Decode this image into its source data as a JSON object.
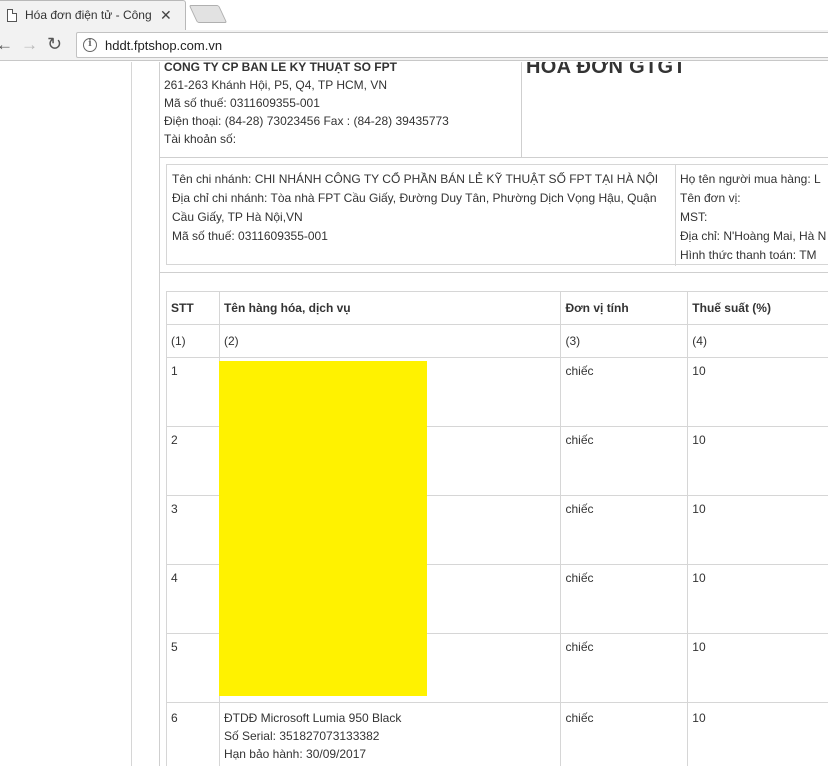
{
  "browser": {
    "tab_title": "Hóa đơn điện tử - Công ty",
    "tab_close": "✕",
    "url": "hddt.fptshop.com.vn",
    "icons": {
      "back": "back-arrow-icon",
      "forward": "forward-arrow-icon",
      "reload": "reload-icon",
      "info": "info-icon",
      "page": "document-icon"
    }
  },
  "seller": {
    "name": "CÔNG TY CP BÁN LẺ KỸ THUẬT SỐ FPT",
    "address": "261-263 Khánh Hội, P5, Q4, TP HCM, VN",
    "tax_code": "Mã số thuế: 0311609355-001",
    "phone": "Điện thoại: (84-28) 73023456 Fax : (84-28) 39435773",
    "account": "Tài khoản số:"
  },
  "doc_title": "HÓA ĐƠN GTGT",
  "branch": {
    "name": "Tên chi nhánh: CHI NHÁNH CÔNG TY CỔ PHẦN BÁN LẺ KỸ THUẬT SỐ FPT TẠI HÀ NỘI",
    "address": "Địa chỉ chi nhánh: Tòa nhà FPT Cầu Giấy, Đường Duy Tân, Phường Dịch Vọng Hậu, Quận Cầu Giấy, TP Hà Nội,VN",
    "tax_code": "Mã số thuế: 0311609355-001"
  },
  "buyer": {
    "name": "Họ tên người mua hàng: L",
    "unit": "Tên đơn vị:",
    "tax_code": "MST:",
    "address": "Địa chỉ: N'Hoàng Mai, Hà N",
    "payment": "Hình thức thanh toán: TM"
  },
  "table": {
    "headers": [
      "STT",
      "Tên hàng hóa, dịch vụ",
      "Đơn vị tính",
      "Thuế suất (%)"
    ],
    "col_numbers": [
      "(1)",
      "(2)",
      "(3)",
      "(4)"
    ],
    "rows": [
      {
        "stt": "1",
        "unit": "chiếc",
        "tax": "10"
      },
      {
        "stt": "2",
        "unit": "chiếc",
        "tax": "10"
      },
      {
        "stt": "3",
        "unit": "chiếc",
        "tax": "10"
      },
      {
        "stt": "4",
        "unit": "chiếc",
        "tax": "10"
      },
      {
        "stt": "5",
        "unit": "chiếc",
        "tax": "10"
      },
      {
        "stt": "6",
        "name_line1": "ĐTDĐ Microsoft Lumia 950 Black",
        "name_line2": "Số Serial: 351827073133382",
        "name_line3": "Hạn bảo hành: 30/09/2017",
        "unit": "chiếc",
        "tax": "10"
      }
    ]
  },
  "colors": {
    "redaction": "#fff200",
    "border": "#d6d6d6",
    "text": "#333333"
  }
}
